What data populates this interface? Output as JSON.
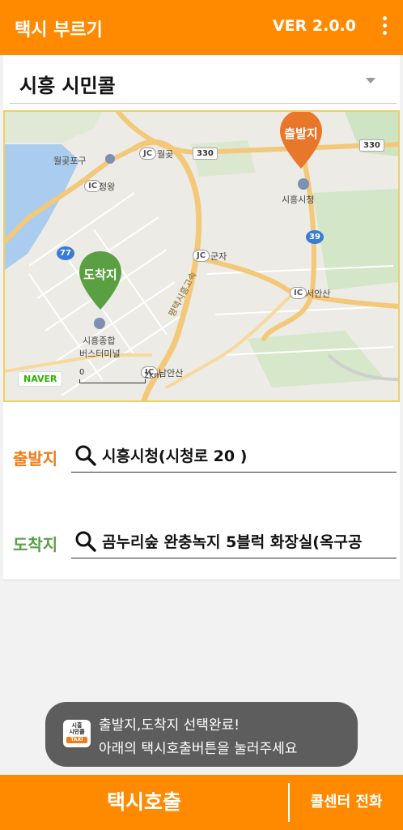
{
  "app": {
    "title": "택시 부르기",
    "version": "VER 2.0.0"
  },
  "company_selector": {
    "selected": "시흥 시민콜"
  },
  "map": {
    "pins": {
      "origin": "출발지",
      "destination": "도착지"
    },
    "pois": {
      "wolgotpogu": "월곶포구",
      "jeongwang": "정왕",
      "wolgot": "월곶",
      "gunja": "군자",
      "seoansan": "서안산",
      "namansan": "남안산",
      "city_hall": "시흥시청",
      "bus_terminal_l1": "시흥종합",
      "bus_terminal_l2": "버스터미널",
      "expressway": "평택시흥고속"
    },
    "route_numbers": {
      "r330a": "330",
      "r330b": "330",
      "r77": "77",
      "r39": "39"
    },
    "interchange": {
      "ic": "IC",
      "jc": "JC"
    },
    "provider": "NAVER",
    "scale": {
      "zero": "0",
      "distance": "2km"
    }
  },
  "route": {
    "origin_label": "출발지",
    "origin_value": "시흥시청(시청로 20 )",
    "destination_label": "도착지",
    "destination_value": "곰누리숲 완충녹지 5블럭 화장실(옥구공"
  },
  "toast": {
    "logo_line1": "시흥",
    "logo_line2": "시민콜",
    "logo_line3": "TAXI",
    "line1": "출발지,도착지 선택완료!",
    "line2": "아래의 택시호출버튼을 눌러주세요"
  },
  "bottom": {
    "call_button": "택시호출",
    "call_center_button": "콜센터 전화"
  },
  "colors": {
    "brand": "#ff8a00",
    "origin": "#f07d18",
    "destination": "#59a04a"
  }
}
